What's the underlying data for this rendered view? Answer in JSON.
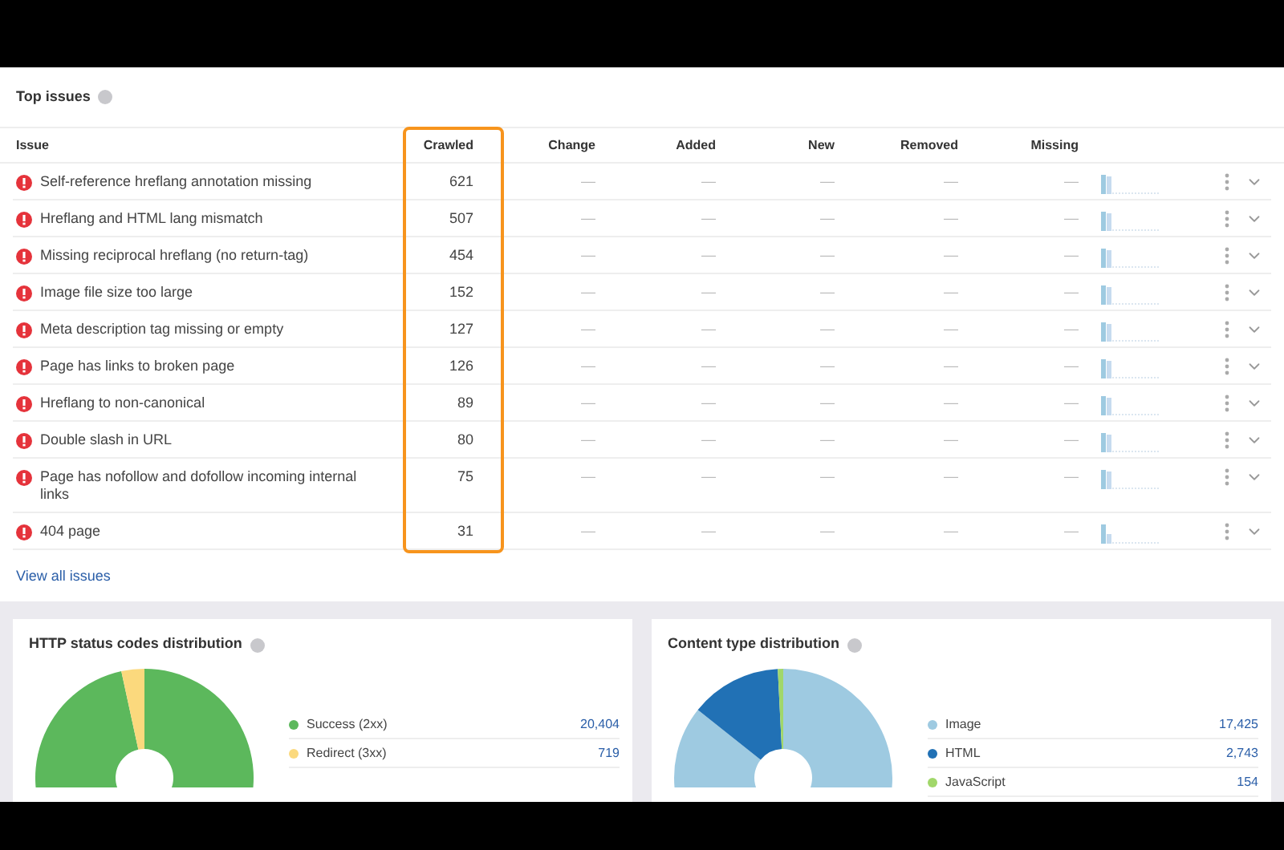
{
  "top_issues": {
    "title": "Top issues",
    "columns": [
      "Issue",
      "Crawled",
      "Change",
      "Added",
      "New",
      "Removed",
      "Missing"
    ],
    "rows": [
      {
        "issue": "Self-reference hreflang annotation missing",
        "crawled": "621",
        "change": "—",
        "added": "—",
        "new": "—",
        "removed": "—",
        "missing": "—"
      },
      {
        "issue": "Hreflang and HTML lang mismatch",
        "crawled": "507",
        "change": "—",
        "added": "—",
        "new": "—",
        "removed": "—",
        "missing": "—"
      },
      {
        "issue": "Missing reciprocal hreflang (no return-tag)",
        "crawled": "454",
        "change": "—",
        "added": "—",
        "new": "—",
        "removed": "—",
        "missing": "—"
      },
      {
        "issue": "Image file size too large",
        "crawled": "152",
        "change": "—",
        "added": "—",
        "new": "—",
        "removed": "—",
        "missing": "—"
      },
      {
        "issue": "Meta description tag missing or empty",
        "crawled": "127",
        "change": "—",
        "added": "—",
        "new": "—",
        "removed": "—",
        "missing": "—"
      },
      {
        "issue": "Page has links to broken page",
        "crawled": "126",
        "change": "—",
        "added": "—",
        "new": "—",
        "removed": "—",
        "missing": "—"
      },
      {
        "issue": "Hreflang to non-canonical",
        "crawled": "89",
        "change": "—",
        "added": "—",
        "new": "—",
        "removed": "—",
        "missing": "—"
      },
      {
        "issue": "Double slash in URL",
        "crawled": "80",
        "change": "—",
        "added": "—",
        "new": "—",
        "removed": "—",
        "missing": "—"
      },
      {
        "issue": "Page has nofollow and dofollow incoming internal links",
        "crawled": "75",
        "change": "—",
        "added": "—",
        "new": "—",
        "removed": "—",
        "missing": "—"
      },
      {
        "issue": "404 page",
        "crawled": "31",
        "change": "—",
        "added": "—",
        "new": "—",
        "removed": "—",
        "missing": "—"
      }
    ],
    "view_all": "View all issues"
  },
  "distributions": [
    {
      "title": "HTTP status codes distribution",
      "legend": [
        {
          "value": "20,404",
          "color": "#5cb85c"
        },
        {
          "value": "719",
          "color": "#fbd97d"
        }
      ],
      "chart_data": {
        "type": "donut",
        "categories": [
          "Success (2xx)",
          "Redirect (3xx)"
        ],
        "values": [
          96.6,
          3.4
        ]
      }
    },
    {
      "title": "Content type distribution",
      "legend": [
        {
          "value": "17,425",
          "color": "#9ecae1"
        },
        {
          "value": "2,743",
          "color": "#2171b5"
        },
        {
          "value": "154",
          "color": "#a1d76a"
        }
      ],
      "chart_data": {
        "type": "donut",
        "categories": [
          "Image",
          "HTML",
          "JavaScript"
        ],
        "values": [
          85.7,
          13.5,
          0.8
        ]
      }
    }
  ]
}
